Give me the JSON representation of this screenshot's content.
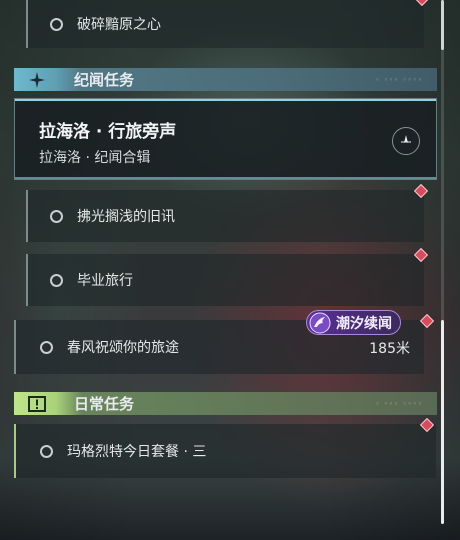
{
  "top_quest": {
    "label": "破碎黯原之心"
  },
  "section_memorial": {
    "title": "纪闻任务",
    "icon": "sparkle-icon",
    "accent": "#7cc9dc"
  },
  "featured_quest": {
    "title": "拉海洛 · 行旅旁声",
    "subtitle": "拉海洛 · 纪闻合辑",
    "icon": "compass-icon"
  },
  "sub_quests": [
    {
      "label": "拂光搁浅的旧讯"
    },
    {
      "label": "毕业旅行"
    }
  ],
  "tracked_quest": {
    "label": "春风祝颂你的旅途",
    "distance": "185米",
    "tag": "潮汐续闻",
    "tag_icon": "tide-wing-icon"
  },
  "section_daily": {
    "title": "日常任务",
    "icon": "exclamation-icon",
    "accent": "#b7dc86"
  },
  "daily_quest": {
    "label": "玛格烈特今日套餐 · 三"
  },
  "colors": {
    "marker": "#d84b5c",
    "tag_purple": "#6c3aa8"
  }
}
